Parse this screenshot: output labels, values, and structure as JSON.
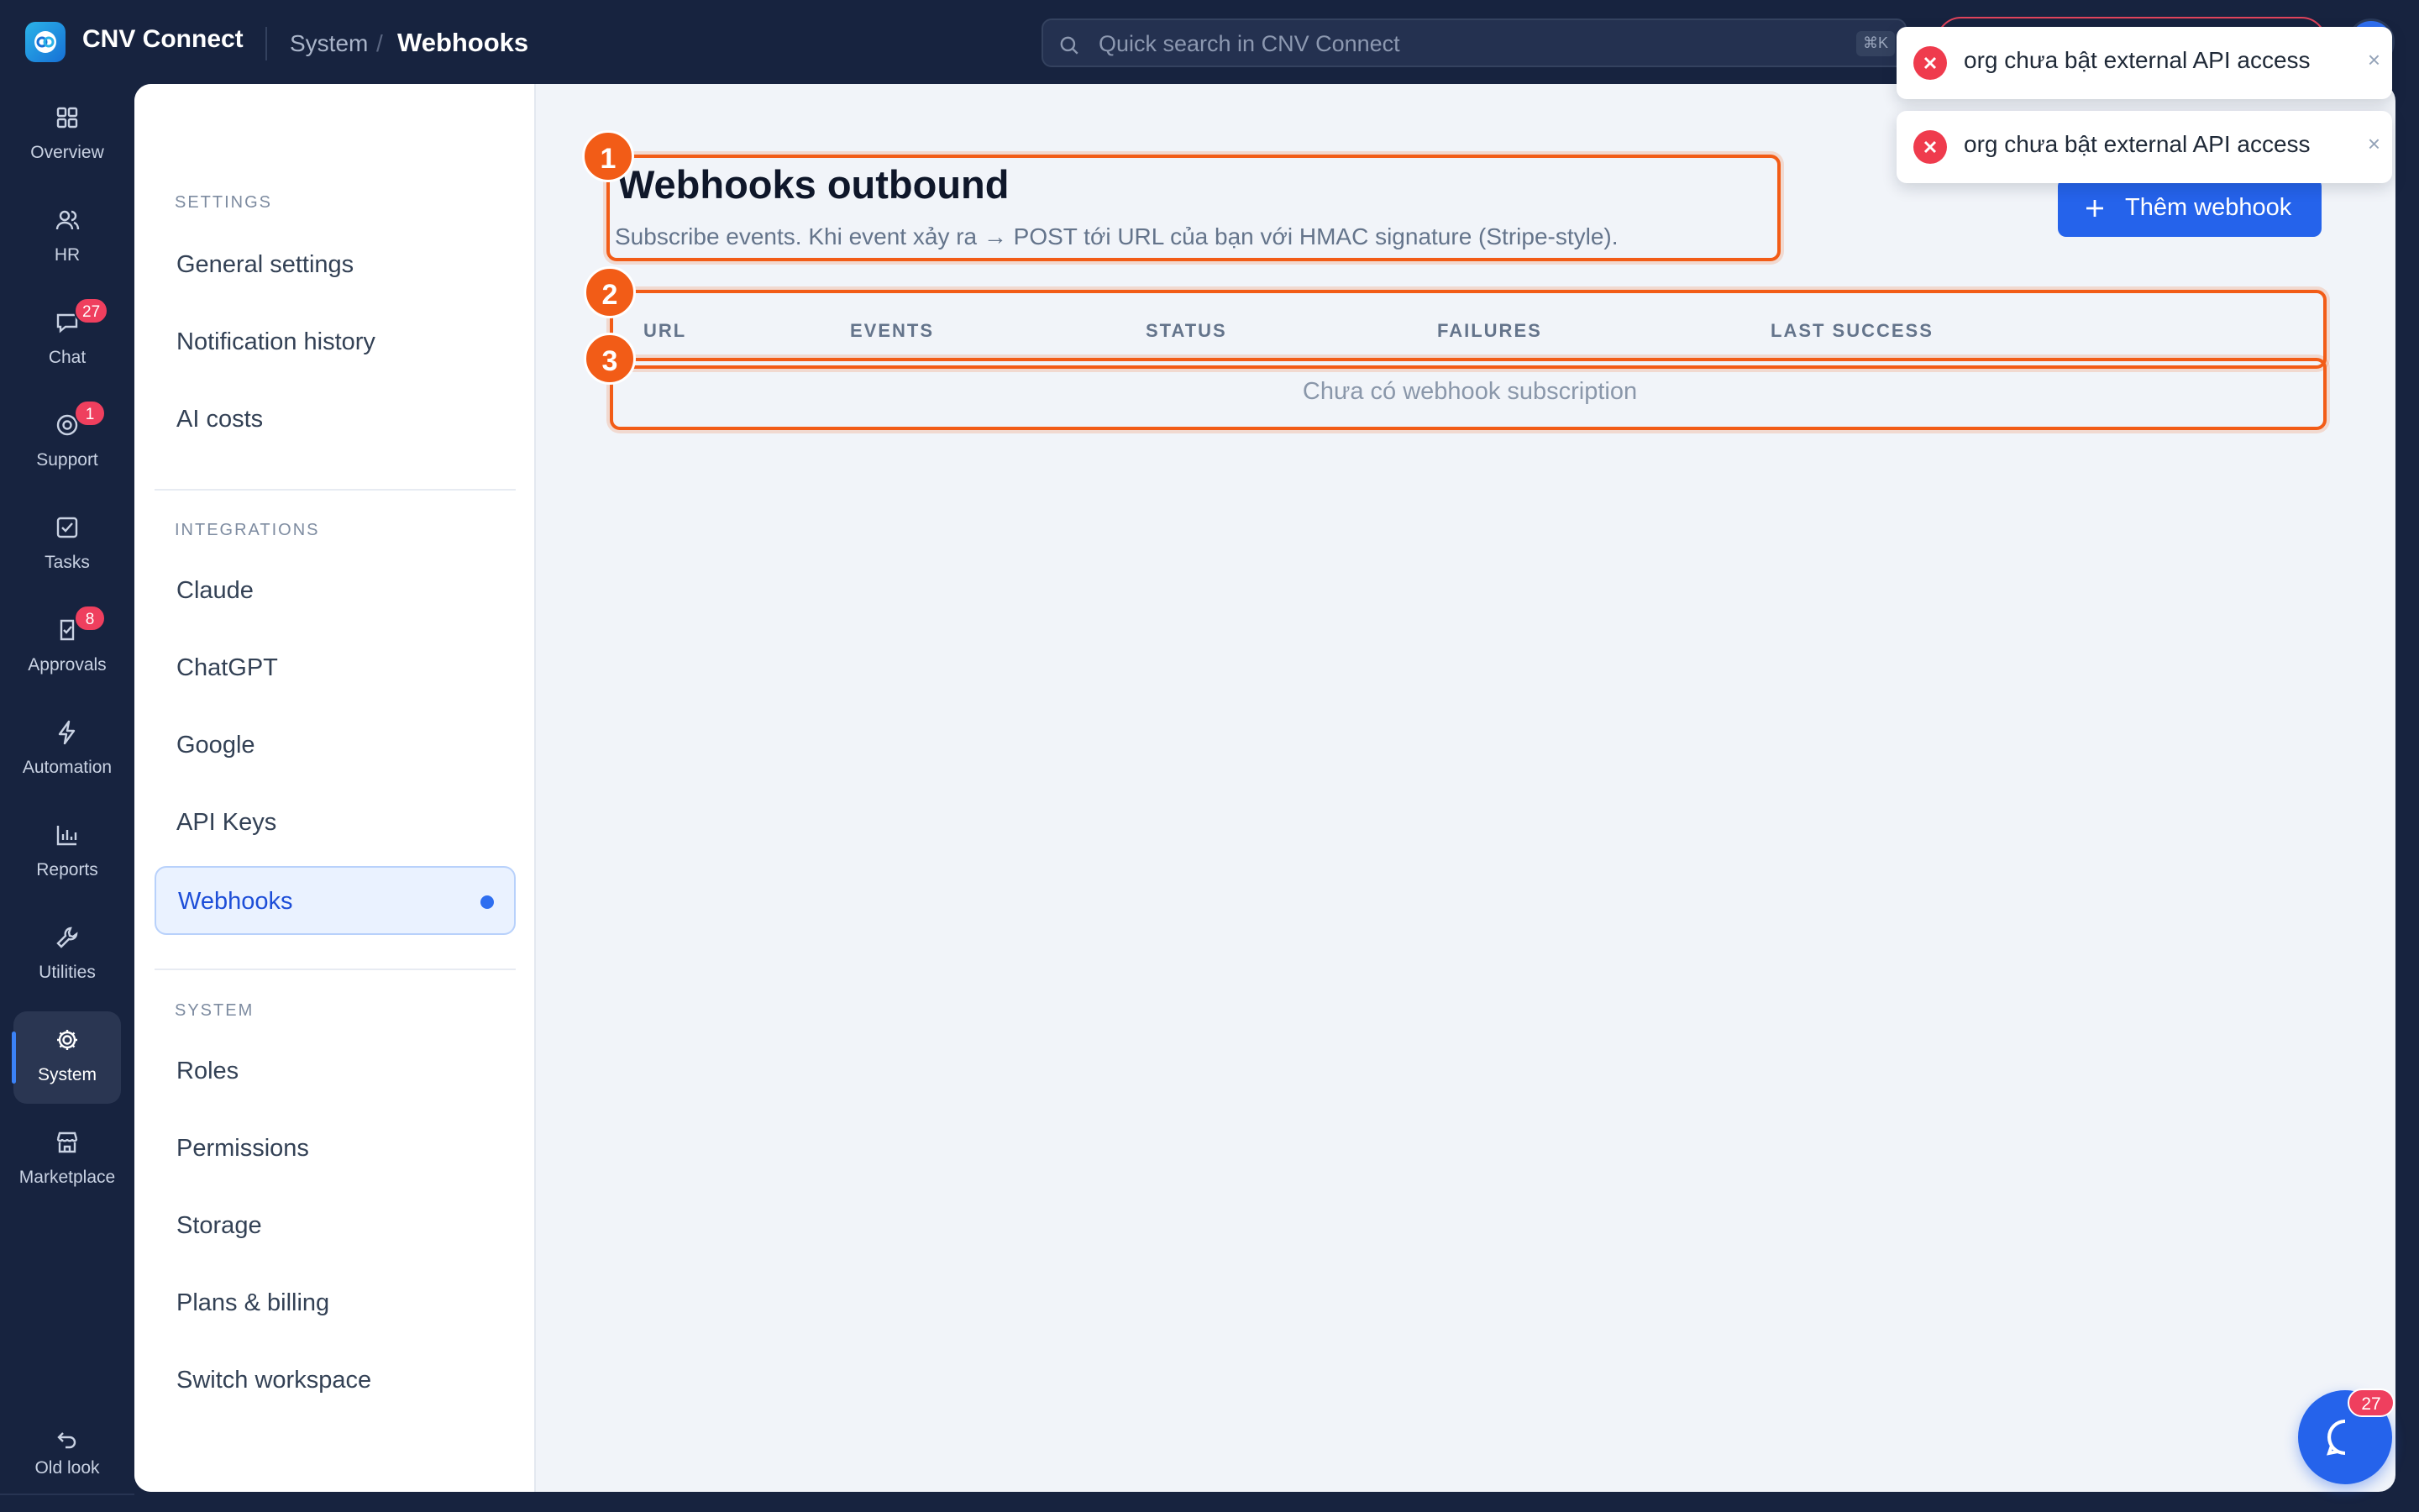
{
  "app": {
    "name": "CNV Connect"
  },
  "breadcrumb": {
    "section": "System",
    "separator": "/",
    "current": "Webhooks"
  },
  "search": {
    "placeholder": "Quick search in CNV Connect",
    "shortcut": "⌘K"
  },
  "rail": {
    "items": [
      {
        "label": "Overview",
        "icon": "grid-icon"
      },
      {
        "label": "HR",
        "icon": "users-icon"
      },
      {
        "label": "Chat",
        "icon": "chat-icon",
        "badge": "27"
      },
      {
        "label": "Support",
        "icon": "lifebuoy-icon",
        "badge": "1"
      },
      {
        "label": "Tasks",
        "icon": "checkbox-icon"
      },
      {
        "label": "Approvals",
        "icon": "approval-icon",
        "badge": "8"
      },
      {
        "label": "Automation",
        "icon": "lightning-icon"
      },
      {
        "label": "Reports",
        "icon": "bar-chart-icon"
      },
      {
        "label": "Utilities",
        "icon": "wrench-icon"
      },
      {
        "label": "System",
        "icon": "gear-icon",
        "active": true
      },
      {
        "label": "Marketplace",
        "icon": "store-icon"
      }
    ],
    "old_look": "Old look"
  },
  "subnav": {
    "settings": {
      "heading": "SETTINGS",
      "items": [
        "General settings",
        "Notification history",
        "AI costs"
      ]
    },
    "integrations": {
      "heading": "INTEGRATIONS",
      "items": [
        "Claude",
        "ChatGPT",
        "Google",
        "API Keys",
        "Webhooks"
      ],
      "active": "Webhooks"
    },
    "system": {
      "heading": "SYSTEM",
      "items": [
        "Roles",
        "Permissions",
        "Storage",
        "Plans & billing",
        "Switch workspace"
      ]
    }
  },
  "main": {
    "title": "Webhooks outbound",
    "subtitle": "Subscribe events. Khi event xảy ra → POST tới URL của bạn với HMAC signature (Stripe-style).",
    "add_button": "Thêm webhook",
    "table": {
      "columns": [
        "URL",
        "EVENTS",
        "STATUS",
        "FAILURES",
        "LAST SUCCESS"
      ],
      "empty": "Chưa có webhook subscription"
    }
  },
  "annotations": [
    "1",
    "2",
    "3"
  ],
  "toasts": [
    {
      "message": "org chưa bật external API access",
      "close": "×"
    },
    {
      "message": "org chưa bật external API access",
      "close": "×"
    }
  ],
  "chat_fab": {
    "badge": "27"
  },
  "colors": {
    "sidebar_bg": "#17233f",
    "accent": "#2563eb",
    "annotation": "#f25c17",
    "error": "#ef3b4d"
  }
}
